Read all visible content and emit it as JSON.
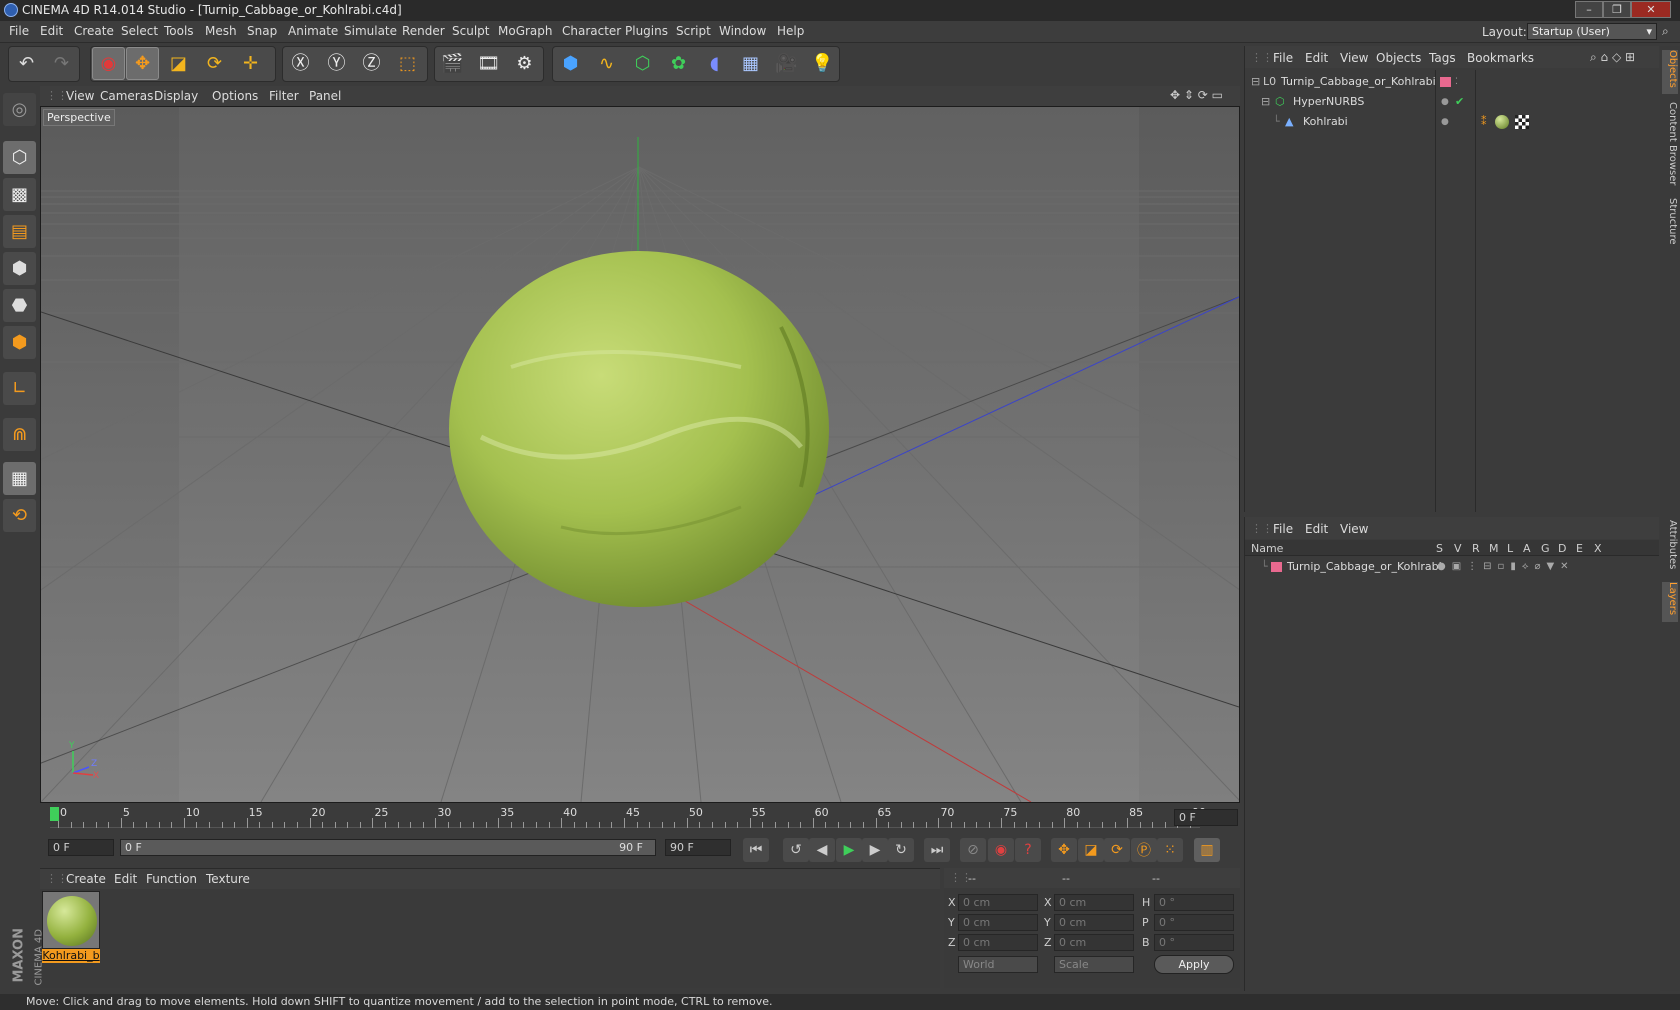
{
  "window": {
    "title": "CINEMA 4D R14.014 Studio - [Turnip_Cabbage_or_Kohlrabi.c4d]",
    "min": "–",
    "max": "❐",
    "close": "✕"
  },
  "menu": [
    "File",
    "Edit",
    "Create",
    "Select",
    "Tools",
    "Mesh",
    "Snap",
    "Animate",
    "Simulate",
    "Render",
    "Sculpt",
    "MoGraph",
    "Character",
    "Plugins",
    "Script",
    "Window",
    "Help"
  ],
  "layout": {
    "label": "Layout:",
    "value": "Startup (User)"
  },
  "viewport": {
    "menu": [
      "View",
      "Cameras",
      "Display",
      "Options",
      "Filter",
      "Panel"
    ],
    "label": "Perspective",
    "axis_y": "Y",
    "axis_z": "Z",
    "axis_x": "X"
  },
  "timeline": {
    "ticks": [
      "0",
      "5",
      "10",
      "15",
      "20",
      "25",
      "30",
      "35",
      "40",
      "45",
      "50",
      "55",
      "60",
      "65",
      "70",
      "75",
      "80",
      "85",
      "90"
    ],
    "current_frame": "0 F"
  },
  "transport": {
    "start_field": "0 F",
    "range_start": "0 F",
    "range_end": "90 F",
    "end_field": "90 F"
  },
  "materials": {
    "menu": [
      "Create",
      "Edit",
      "Function",
      "Texture"
    ],
    "item_label": "Kohlrabi_b"
  },
  "coordinates": {
    "header": [
      "--",
      "--",
      "--"
    ],
    "pos": [
      {
        "axis": "X",
        "value": "0 cm"
      },
      {
        "axis": "Y",
        "value": "0 cm"
      },
      {
        "axis": "Z",
        "value": "0 cm"
      }
    ],
    "size": [
      {
        "axis": "X",
        "value": "0 cm"
      },
      {
        "axis": "Y",
        "value": "0 cm"
      },
      {
        "axis": "Z",
        "value": "0 cm"
      }
    ],
    "rot": [
      {
        "axis": "H",
        "value": "0 °"
      },
      {
        "axis": "P",
        "value": "0 °"
      },
      {
        "axis": "B",
        "value": "0 °"
      }
    ],
    "world": "World",
    "scale": "Scale",
    "apply": "Apply"
  },
  "objects": {
    "menu": [
      "File",
      "Edit",
      "View",
      "Objects",
      "Tags",
      "Bookmarks"
    ],
    "rows": [
      "Turnip_Cabbage_or_Kohlrabi",
      "HyperNURBS",
      "Kohlrabi"
    ]
  },
  "layers": {
    "menu": [
      "File",
      "Edit",
      "View"
    ],
    "columns": [
      "Name",
      "S",
      "V",
      "R",
      "M",
      "L",
      "A",
      "G",
      "D",
      "E",
      "X"
    ],
    "row": "Turnip_Cabbage_or_Kohlrabi"
  },
  "side_tabs": [
    "Objects",
    "Content Browser",
    "Structure",
    "Attributes",
    "Layers"
  ],
  "status": "Move: Click and drag to move elements. Hold down SHIFT to quantize movement / add to the selection in point mode, CTRL to remove.",
  "brand": {
    "maxon": "MAXON",
    "product": "CINEMA 4D"
  },
  "colors": {
    "accent": "#f39a1e",
    "layer": "#e8698f",
    "green": "#3fce5a"
  }
}
